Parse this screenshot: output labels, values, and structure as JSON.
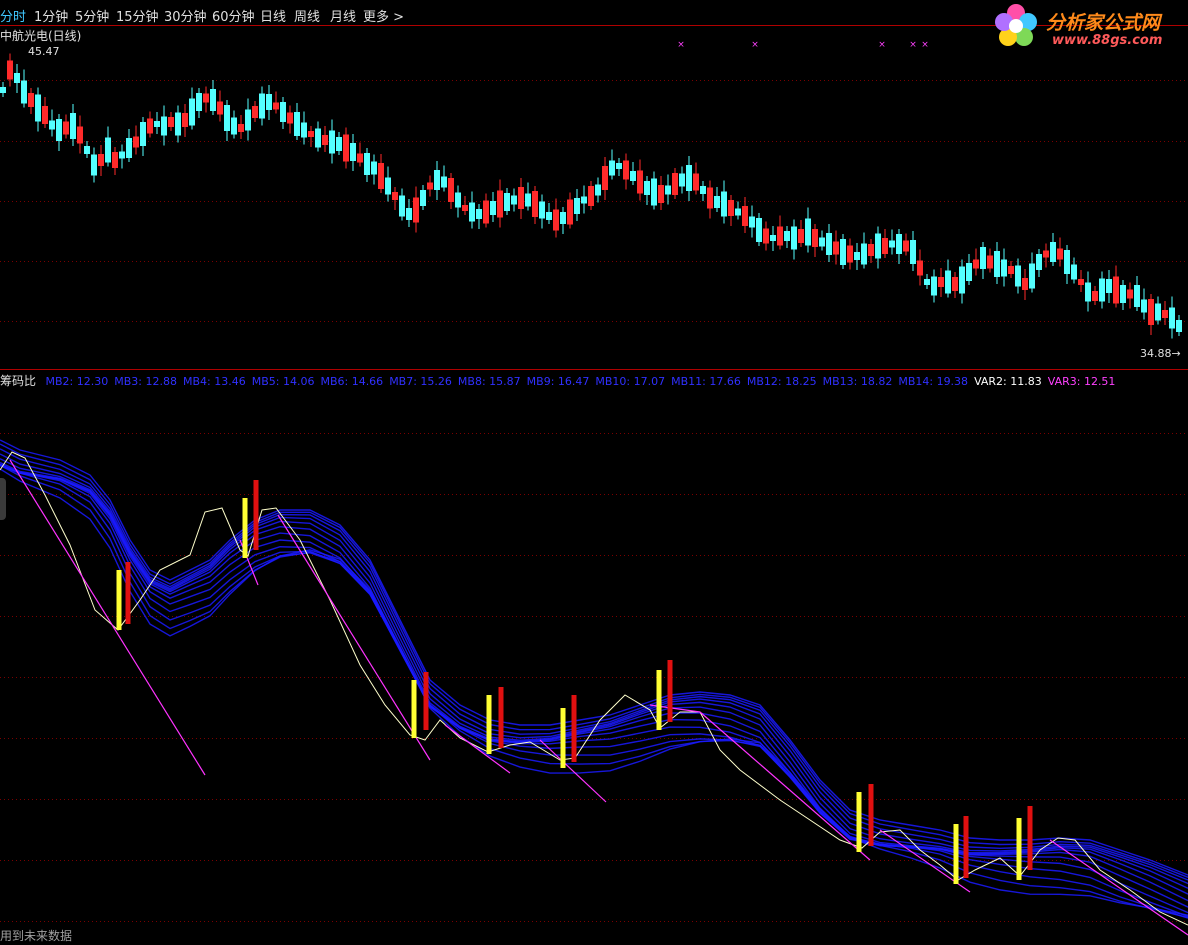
{
  "tabs": [
    {
      "label": "分时",
      "active": true
    },
    {
      "label": "1分钟",
      "active": false
    },
    {
      "label": "5分钟",
      "active": false
    },
    {
      "label": "15分钟",
      "active": false
    },
    {
      "label": "30分钟",
      "active": false
    },
    {
      "label": "60分钟",
      "active": false
    },
    {
      "label": "日线",
      "active": false
    },
    {
      "label": "周线",
      "active": false
    },
    {
      "label": "月线",
      "active": false
    },
    {
      "label": "更多",
      "active": false
    }
  ],
  "more_arrow": ">",
  "logo": {
    "text": "分析家公式网",
    "url": "www.88gs.com"
  },
  "main_pane": {
    "title": "中航光电(日线)",
    "high_label": "45.47",
    "low_label": "34.88",
    "low_arrow": "→"
  },
  "indicator": {
    "title": "筹码比",
    "legend": [
      {
        "name": "MB2",
        "value": "12.30",
        "color": "#3030ff"
      },
      {
        "name": "MB3",
        "value": "12.88",
        "color": "#3030ff"
      },
      {
        "name": "MB4",
        "value": "13.46",
        "color": "#3030ff"
      },
      {
        "name": "MB5",
        "value": "14.06",
        "color": "#3030ff"
      },
      {
        "name": "MB6",
        "value": "14.66",
        "color": "#3030ff"
      },
      {
        "name": "MB7",
        "value": "15.26",
        "color": "#3030ff"
      },
      {
        "name": "MB8",
        "value": "15.87",
        "color": "#3030ff"
      },
      {
        "name": "MB9",
        "value": "16.47",
        "color": "#3030ff"
      },
      {
        "name": "MB10",
        "value": "17.07",
        "color": "#3030ff"
      },
      {
        "name": "MB11",
        "value": "17.66",
        "color": "#3030ff"
      },
      {
        "name": "MB12",
        "value": "18.25",
        "color": "#3030ff"
      },
      {
        "name": "MB13",
        "value": "18.82",
        "color": "#3030ff"
      },
      {
        "name": "MB14",
        "value": "19.38",
        "color": "#3030ff"
      },
      {
        "name": "VAR2",
        "value": "11.83",
        "color": "#ffffff"
      },
      {
        "name": "VAR3",
        "value": "12.51",
        "color": "#ff40ff"
      }
    ]
  },
  "status_text": "用到未来数据",
  "colors": {
    "up": "#ff2a2a",
    "down": "#54ffff",
    "grid": "#7a0000",
    "ribbon": "#1a1aff",
    "signal_yellow": "#ffff33",
    "signal_red": "#e01010",
    "trend_magenta": "#ff33ff"
  }
}
